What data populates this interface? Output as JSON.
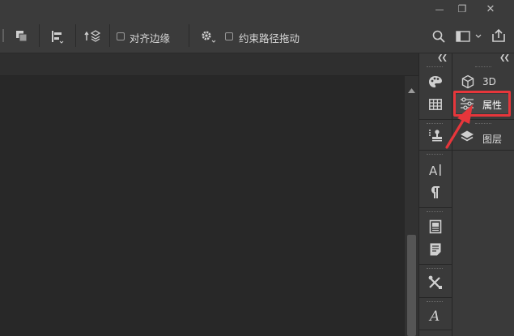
{
  "window_controls": {
    "minimize_glyph": "—",
    "restore_glyph": "❐",
    "close_glyph": "✕"
  },
  "options_bar": {
    "align_edges_label": "对齐边缘",
    "constrain_path_label": "约束路径拖动"
  },
  "panels": {
    "items": [
      {
        "label": "3D"
      },
      {
        "label": "属性"
      },
      {
        "label": "图层"
      }
    ]
  },
  "colors": {
    "highlight": "#e6363b",
    "panel_bg": "#3a3a3a",
    "canvas_bg": "#282828"
  }
}
